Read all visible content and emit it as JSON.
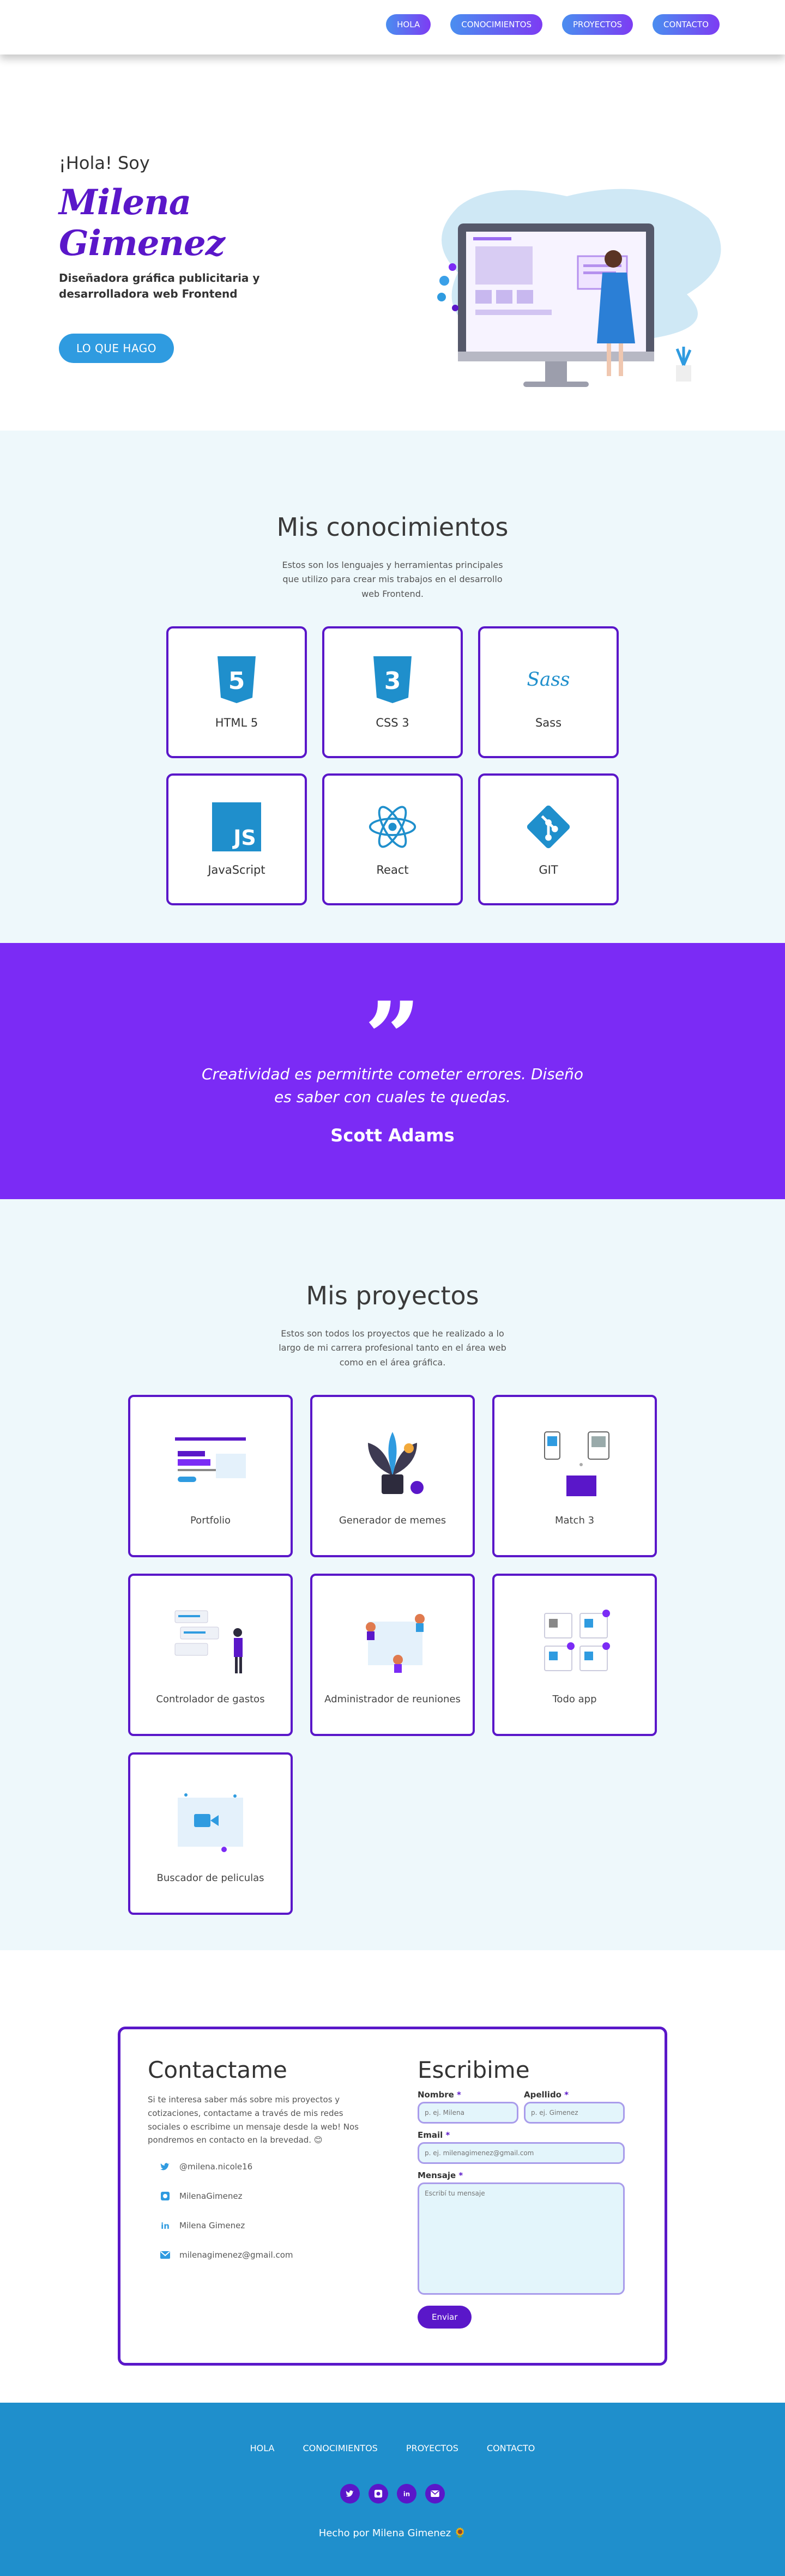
{
  "nav": {
    "items": [
      "HOLA",
      "CONOCIMIENTOS",
      "PROYECTOS",
      "CONTACTO"
    ]
  },
  "hero": {
    "greeting": "¡Hola! Soy",
    "name": "Milena Gimenez",
    "subtitle": "Diseñadora gráfica publicitaria y desarrolladora web Frontend",
    "cta": "LO QUE HAGO"
  },
  "skills": {
    "title": "Mis conocimientos",
    "description": "Estos son los lenguajes y herramientas principales que utilizo para crear mis trabajos en el desarrollo web Frontend.",
    "items": [
      {
        "label": "HTML 5",
        "icon": "html5-icon"
      },
      {
        "label": "CSS 3",
        "icon": "css3-icon"
      },
      {
        "label": "Sass",
        "icon": "sass-icon"
      },
      {
        "label": "JavaScript",
        "icon": "javascript-icon"
      },
      {
        "label": "React",
        "icon": "react-icon"
      },
      {
        "label": "GIT",
        "icon": "git-icon"
      }
    ]
  },
  "quote": {
    "text": "Creatividad es permitirte cometer errores. Diseño es saber con cuales te quedas.",
    "author": "Scott Adams"
  },
  "projects": {
    "title": "Mis proyectos",
    "description": "Estos son todos los proyectos que he realizado a lo largo de mi carrera profesional tanto en el área web como en el área gráfica.",
    "items": [
      {
        "label": "Portfolio"
      },
      {
        "label": "Generador de memes"
      },
      {
        "label": "Match 3"
      },
      {
        "label": "Controlador de gastos"
      },
      {
        "label": "Administrador de reuniones"
      },
      {
        "label": "Todo app"
      },
      {
        "label": "Buscador de peliculas"
      }
    ]
  },
  "contact": {
    "title": "Contactame",
    "description": "Si te interesa saber más sobre mis proyectos y cotizaciones, contactame a través de mis redes sociales o escribime un mensaje desde la web! Nos pondremos en contacto en la brevedad. 😊",
    "socials": [
      {
        "icon": "twitter-icon",
        "text": "@milena.nicole16"
      },
      {
        "icon": "github-icon",
        "text": "MilenaGimenez"
      },
      {
        "icon": "linkedin-icon",
        "text": "Milena Gimenez"
      },
      {
        "icon": "mail-icon",
        "text": "milenagimenez@gmail.com"
      }
    ]
  },
  "form": {
    "title": "Escribime",
    "name_label": "Nombre",
    "name_placeholder": "p. ej. Milena",
    "lastname_label": "Apellido",
    "lastname_placeholder": "p. ej. Gimenez",
    "email_label": "Email",
    "email_placeholder": "p. ej. milenagimenez@gmail.com",
    "message_label": "Mensaje",
    "message_placeholder": "Escribí tu mensaje",
    "required_mark": "*",
    "submit": "Enviar"
  },
  "footer": {
    "nav": [
      "HOLA",
      "CONOCIMIENTOS",
      "PROYECTOS",
      "CONTACTO"
    ],
    "icons": [
      "twitter-icon",
      "github-icon",
      "linkedin-icon",
      "mail-icon"
    ],
    "credit": "Hecho por Milena Gimenez 🌻"
  },
  "colors": {
    "purple": "#5a17c9",
    "violet": "#7b2bf5",
    "blue": "#2f9be0",
    "footer": "#1f8fcc",
    "light_bg": "#eef8fb"
  }
}
